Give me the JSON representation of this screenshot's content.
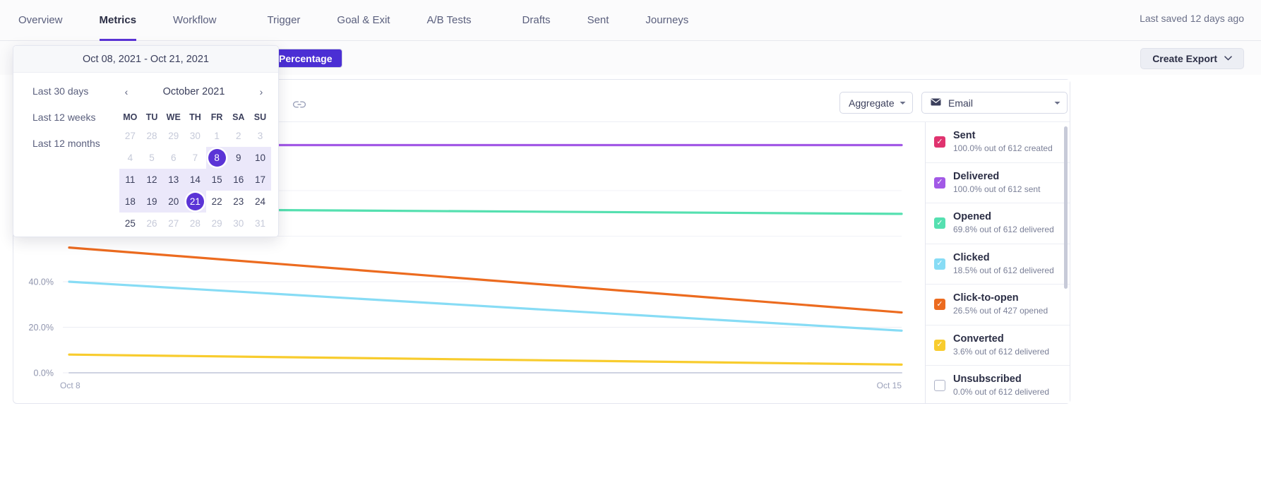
{
  "topnav": {
    "items": [
      {
        "label": "Overview",
        "active": false
      },
      {
        "label": "Metrics",
        "active": true
      },
      {
        "label": "Workflow",
        "active": false
      },
      {
        "label": "Trigger",
        "active": false
      },
      {
        "label": "Goal & Exit",
        "active": false
      },
      {
        "label": "A/B Tests",
        "active": false
      },
      {
        "label": "Drafts",
        "active": false
      },
      {
        "label": "Sent",
        "active": false
      },
      {
        "label": "Journeys",
        "active": false
      }
    ],
    "last_saved": "Last saved 12 days ago"
  },
  "subbar": {
    "toggle_label": "Percentage",
    "create_export": "Create Export",
    "chevron": "⌄"
  },
  "chart_toolbar": {
    "link_icon": "link-icon",
    "aggregate": "Aggregate",
    "channel": "Email",
    "mail_glyph": "✉",
    "caret": "▾"
  },
  "datepicker": {
    "range_label": "Oct 08, 2021 - Oct 21, 2021",
    "presets": [
      "Last 30 days",
      "Last 12 weeks",
      "Last 12 months"
    ],
    "prev_arrow": "‹",
    "next_arrow": "›",
    "month_label": "October 2021",
    "dow": [
      "MO",
      "TU",
      "WE",
      "TH",
      "FR",
      "SA",
      "SU"
    ],
    "weeks": [
      [
        {
          "d": "27",
          "state": "muted"
        },
        {
          "d": "28",
          "state": "muted"
        },
        {
          "d": "29",
          "state": "muted"
        },
        {
          "d": "30",
          "state": "muted"
        },
        {
          "d": "1",
          "state": "muted"
        },
        {
          "d": "2",
          "state": "muted"
        },
        {
          "d": "3",
          "state": "muted"
        }
      ],
      [
        {
          "d": "4",
          "state": "muted"
        },
        {
          "d": "5",
          "state": "muted"
        },
        {
          "d": "6",
          "state": "muted"
        },
        {
          "d": "7",
          "state": "muted"
        },
        {
          "d": "8",
          "state": "selected-start"
        },
        {
          "d": "9",
          "state": "inrange"
        },
        {
          "d": "10",
          "state": "inrange"
        }
      ],
      [
        {
          "d": "11",
          "state": "inrange"
        },
        {
          "d": "12",
          "state": "inrange"
        },
        {
          "d": "13",
          "state": "inrange"
        },
        {
          "d": "14",
          "state": "inrange"
        },
        {
          "d": "15",
          "state": "inrange"
        },
        {
          "d": "16",
          "state": "inrange"
        },
        {
          "d": "17",
          "state": "inrange"
        }
      ],
      [
        {
          "d": "18",
          "state": "inrange"
        },
        {
          "d": "19",
          "state": "inrange"
        },
        {
          "d": "20",
          "state": "inrange"
        },
        {
          "d": "21",
          "state": "selected-end"
        },
        {
          "d": "22",
          "state": "normal"
        },
        {
          "d": "23",
          "state": "normal"
        },
        {
          "d": "24",
          "state": "normal"
        }
      ],
      [
        {
          "d": "25",
          "state": "normal"
        },
        {
          "d": "26",
          "state": "muted"
        },
        {
          "d": "27",
          "state": "muted"
        },
        {
          "d": "28",
          "state": "muted"
        },
        {
          "d": "29",
          "state": "muted"
        },
        {
          "d": "30",
          "state": "muted"
        },
        {
          "d": "31",
          "state": "muted"
        }
      ]
    ]
  },
  "legend": {
    "items": [
      {
        "label": "Sent",
        "sub": "100.0% out of 612 created",
        "color": "#e0336f",
        "checked": true
      },
      {
        "label": "Delivered",
        "sub": "100.0% out of 612 sent",
        "color": "#a259e6",
        "checked": true
      },
      {
        "label": "Opened",
        "sub": "69.8% out of 612 delivered",
        "color": "#55e0b0",
        "checked": true
      },
      {
        "label": "Clicked",
        "sub": "18.5% out of 612 delivered",
        "color": "#87dcf5",
        "checked": true
      },
      {
        "label": "Click-to-open",
        "sub": "26.5% out of 427 opened",
        "color": "#ec6b1f",
        "checked": true
      },
      {
        "label": "Converted",
        "sub": "3.6% out of 612 delivered",
        "color": "#f8cc2e",
        "checked": true
      },
      {
        "label": "Unsubscribed",
        "sub": "0.0% out of 612 delivered",
        "color": "#ffffff",
        "checked": false
      }
    ],
    "check_glyph": "✓"
  },
  "chart_data": {
    "type": "line",
    "title": "",
    "xlabel": "",
    "ylabel": "",
    "x": [
      "Oct 8",
      "Oct 15"
    ],
    "xtick_labels": [
      "Oct 8",
      "Oct 15"
    ],
    "ytick_labels": [
      "0.0%",
      "20.0%",
      "40.0%"
    ],
    "ylim": [
      0,
      110
    ],
    "grid": true,
    "legend_position": "right",
    "series": [
      {
        "name": "Sent",
        "color": "#e0336f",
        "values": [
          100.0,
          100.0
        ],
        "visible": false
      },
      {
        "name": "Delivered",
        "color": "#a259e6",
        "values": [
          100.0,
          100.0
        ],
        "visible": true
      },
      {
        "name": "Opened",
        "color": "#55e0b0",
        "values": [
          72.0,
          69.8
        ],
        "visible": true
      },
      {
        "name": "Clicked",
        "color": "#87dcf5",
        "values": [
          40.0,
          18.5
        ],
        "visible": true
      },
      {
        "name": "Click-to-open",
        "color": "#ec6b1f",
        "values": [
          55.0,
          26.5
        ],
        "visible": true
      },
      {
        "name": "Converted",
        "color": "#f8cc2e",
        "values": [
          8.0,
          3.6
        ],
        "visible": true
      },
      {
        "name": "Unsubscribed",
        "color": "#cfd3e2",
        "values": [
          0.0,
          0.0
        ],
        "visible": true
      }
    ]
  }
}
